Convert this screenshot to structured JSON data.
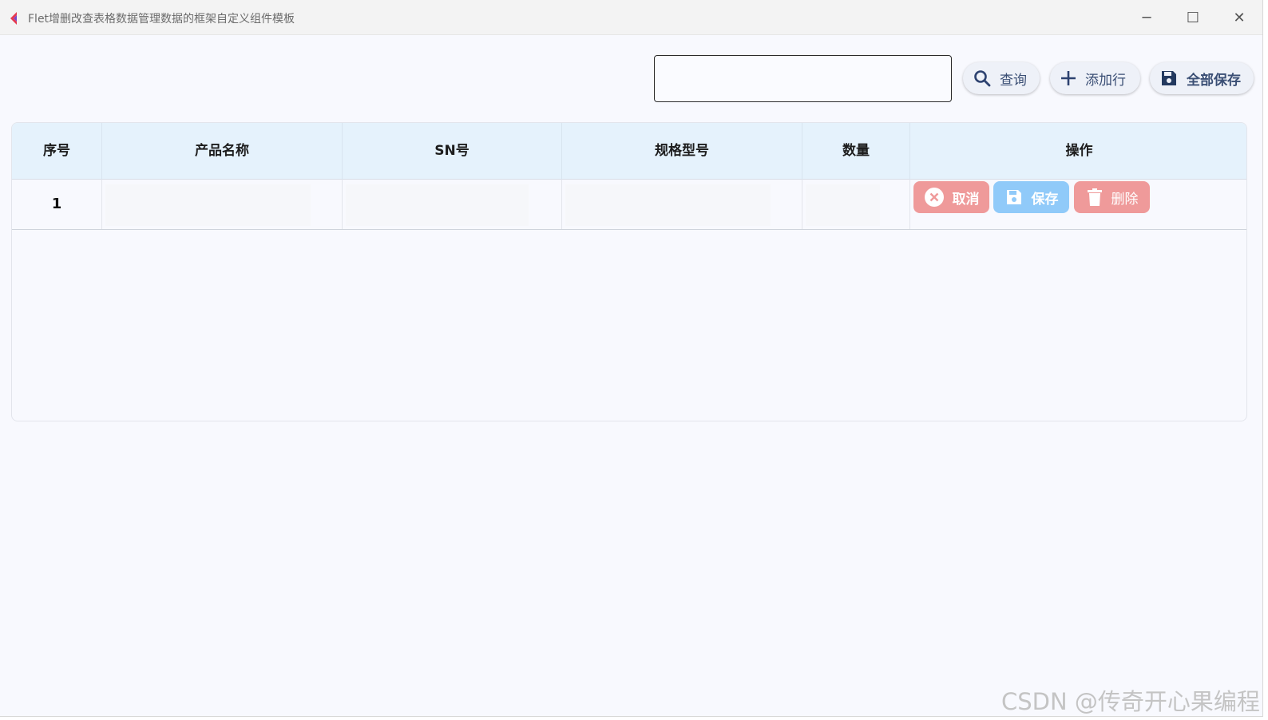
{
  "window": {
    "title": "Flet增删改查表格数据管理数据的框架自定义组件模板",
    "minimize_glyph": "─",
    "maximize_glyph": "☐",
    "close_glyph": "✕"
  },
  "toolbar": {
    "search_value": "",
    "search_placeholder": "",
    "query_label": "查询",
    "add_row_label": "添加行",
    "save_all_label": "全部保存",
    "icons": {
      "query": "search-icon",
      "add": "plus-icon",
      "save_all": "floppy-disk-icon"
    },
    "text_color": "#3b4f75"
  },
  "table": {
    "columns": [
      "序号",
      "产品名称",
      "SN号",
      "规格型号",
      "数量",
      "操作"
    ],
    "header_bg": "#e5f2fc",
    "rows": [
      {
        "index": "1",
        "product_name": "",
        "sn": "",
        "spec": "",
        "quantity": "",
        "actions": {
          "cancel_label": "取消",
          "save_label": "保存",
          "delete_label": "删除",
          "cancel_color": "#ef9a9a",
          "save_color": "#90caf9",
          "delete_color": "#ef9a9a"
        }
      }
    ]
  },
  "watermark": "CSDN @传奇开心果编程"
}
